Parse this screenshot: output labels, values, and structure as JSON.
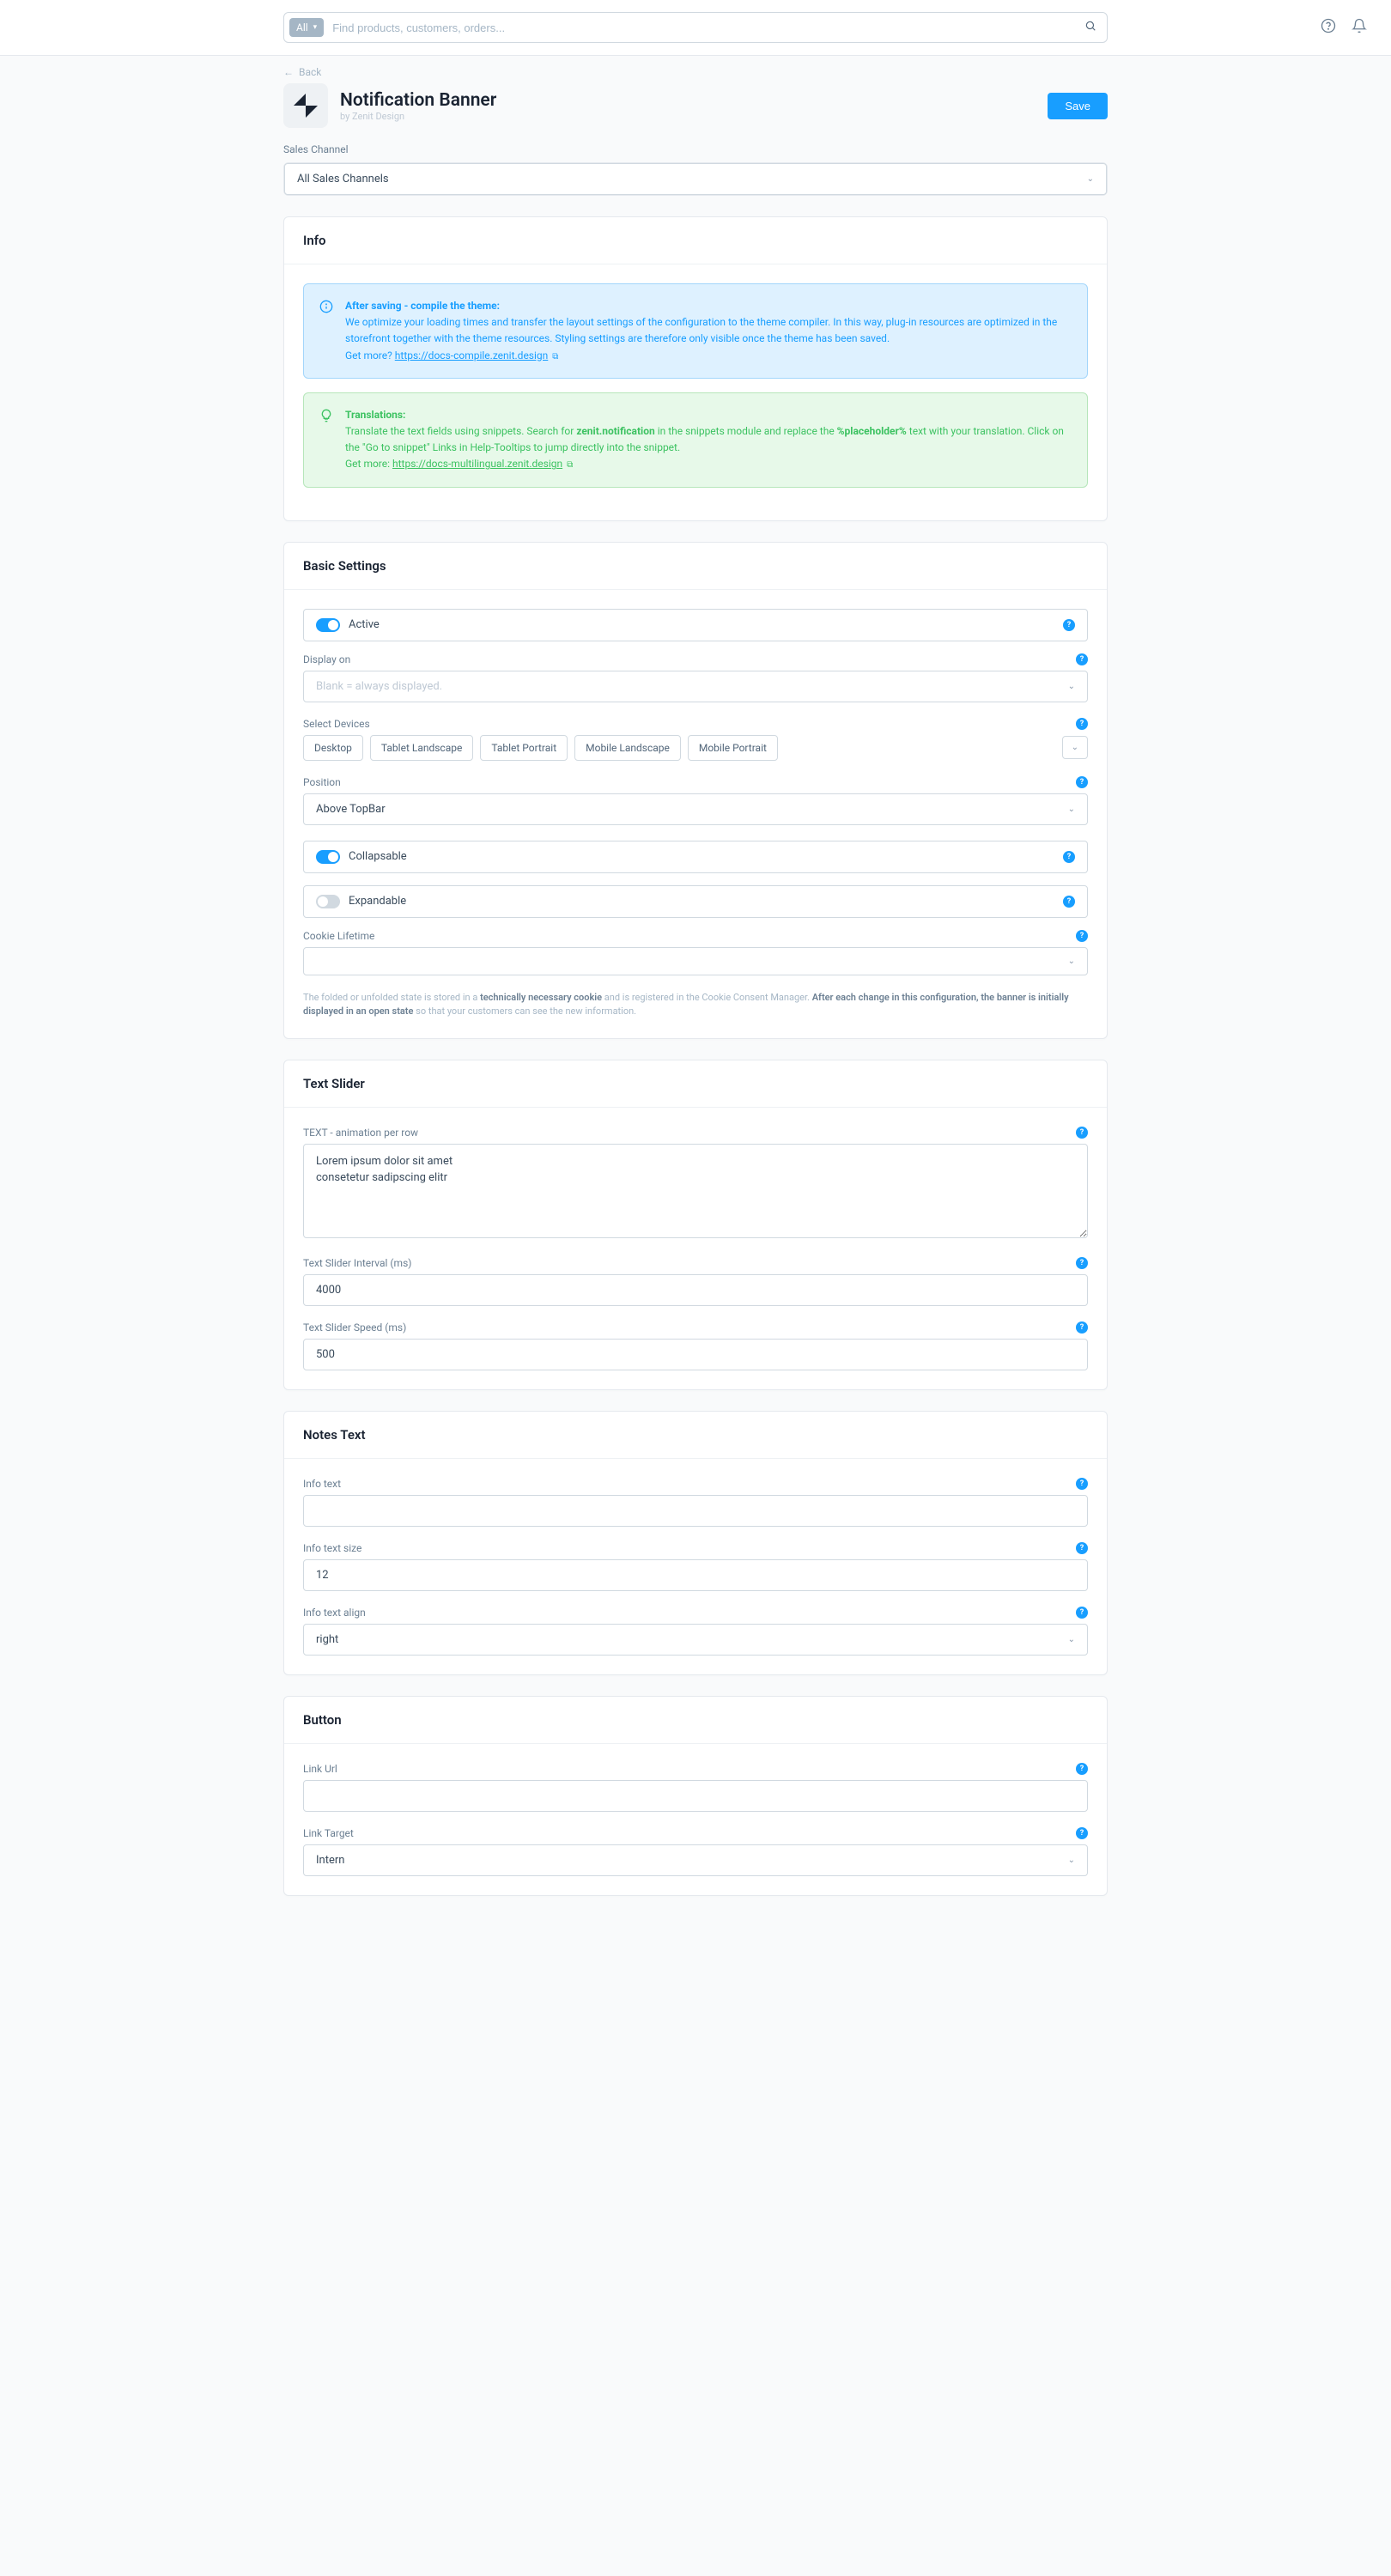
{
  "search": {
    "scope": "All",
    "placeholder": "Find products, customers, orders..."
  },
  "back": "Back",
  "page": {
    "title": "Notification Banner",
    "by": "by Zenit Design",
    "save": "Save"
  },
  "salesChannel": {
    "label": "Sales Channel",
    "selected": "All Sales Channels"
  },
  "info": {
    "title": "Info",
    "compile": {
      "heading": "After saving - compile the theme:",
      "body": "We optimize your loading times and transfer the layout settings of the configuration to the theme compiler. In this way, plug-in resources are optimized in the storefront together with the theme resources. Styling settings are therefore only visible once the theme has been saved.",
      "getMore": "Get more?",
      "link": "https://docs-compile.zenit.design"
    },
    "translations": {
      "heading": "Translations:",
      "body1": "Translate the text fields using snippets. Search for ",
      "bold1": "zenit.notification",
      "body2": " in the snippets module and replace the ",
      "bold2": "%placeholder%",
      "body3": " text with your translation. Click on the \"Go to snippet\" Links in Help-Tooltips to jump directly into the snippet.",
      "getMore": "Get more:",
      "link": "https://docs-multilingual.zenit.design"
    }
  },
  "basic": {
    "title": "Basic Settings",
    "active": "Active",
    "displayOn": {
      "label": "Display on",
      "placeholder": "Blank = always displayed."
    },
    "selectDevices": {
      "label": "Select Devices",
      "options": [
        "Desktop",
        "Tablet Landscape",
        "Tablet Portrait",
        "Mobile Landscape",
        "Mobile Portrait"
      ]
    },
    "position": {
      "label": "Position",
      "value": "Above TopBar"
    },
    "collapsable": "Collapsable",
    "expandable": "Expandable",
    "cookieLifetime": {
      "label": "Cookie Lifetime",
      "value": ""
    },
    "hint": {
      "p1": "The folded or unfolded state is stored in a ",
      "b1": "technically necessary cookie",
      "p2": " and is registered in the Cookie Consent Manager. ",
      "b2": "After each change in this configuration, the banner is initially displayed in an open state",
      "p3": " so that your customers can see the new information."
    }
  },
  "textSlider": {
    "title": "Text Slider",
    "text": {
      "label": "TEXT - animation per row",
      "value": "Lorem ipsum dolor sit amet\nconsetetur sadipscing elitr"
    },
    "interval": {
      "label": "Text Slider Interval (ms)",
      "value": "4000"
    },
    "speed": {
      "label": "Text Slider Speed (ms)",
      "value": "500"
    }
  },
  "notesText": {
    "title": "Notes Text",
    "infoText": {
      "label": "Info text",
      "value": ""
    },
    "infoTextSize": {
      "label": "Info text size",
      "value": "12"
    },
    "infoTextAlign": {
      "label": "Info text align",
      "value": "right"
    }
  },
  "button": {
    "title": "Button",
    "linkUrl": {
      "label": "Link Url",
      "value": ""
    },
    "linkTarget": {
      "label": "Link Target",
      "value": "Intern"
    }
  }
}
